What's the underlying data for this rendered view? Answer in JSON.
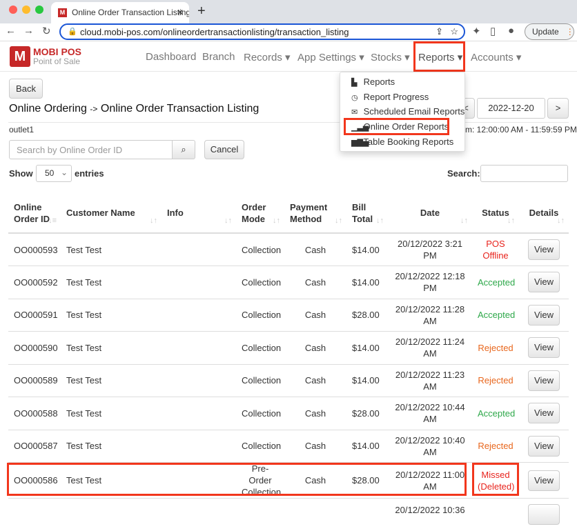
{
  "browser": {
    "tab_title": "Online Order Transaction Listing",
    "url": "cloud.mobi-pos.com/onlineordertransactionlisting/transaction_listing",
    "update_label": "Update"
  },
  "brand": {
    "name": "MOBI POS",
    "tagline": "Point of Sale",
    "color": "#c62828"
  },
  "nav": [
    "Dashboard",
    "Branch",
    "Records ▾",
    "App Settings ▾",
    "Stocks ▾",
    "Reports ▾",
    "Accounts ▾"
  ],
  "reports_menu": [
    {
      "icon": "file-icon",
      "glyph": "▙",
      "label": "Reports"
    },
    {
      "icon": "clock-icon",
      "glyph": "◷",
      "label": "Report Progress"
    },
    {
      "icon": "envelope-icon",
      "glyph": "✉",
      "label": "Scheduled Email Reports"
    },
    {
      "icon": "signal-icon",
      "glyph": "▁▃▅",
      "label": "Online Order Reports"
    },
    {
      "icon": "bar-chart-icon",
      "glyph": "▆▇▅",
      "label": "Table Booking Reports"
    }
  ],
  "page": {
    "back": "Back",
    "breadcrumb_1": "Online Ordering",
    "arrow": "->",
    "breadcrumb_2": "Online Order Transaction Listing",
    "outlet": "outlet1",
    "date": "2022-12-20",
    "prev": "<",
    "next": ">",
    "time_range": "m: 12:00:00 AM - 11:59:59 PM",
    "search_placeholder": "Search by Online Order ID",
    "cancel": "Cancel",
    "show": "Show",
    "entries_value": "50",
    "entries": "entries",
    "search_label": "Search:"
  },
  "table": {
    "headers": [
      "Online Order ID",
      "Customer Name",
      "Info",
      "Order Mode",
      "Payment Method",
      "Bill Total",
      "Date",
      "Status",
      "Details"
    ],
    "rows": [
      [
        "OO000593",
        "Test Test",
        "",
        "Collection",
        "Cash",
        "$14.00",
        "20/12/2022 3:21 PM",
        "POS Offline",
        "View",
        "#e8231c"
      ],
      [
        "OO000592",
        "Test Test",
        "",
        "Collection",
        "Cash",
        "$14.00",
        "20/12/2022 12:18 PM",
        "Accepted",
        "View",
        "#2ea84a"
      ],
      [
        "OO000591",
        "Test Test",
        "",
        "Collection",
        "Cash",
        "$28.00",
        "20/12/2022 11:28 AM",
        "Accepted",
        "View",
        "#2ea84a"
      ],
      [
        "OO000590",
        "Test Test",
        "",
        "Collection",
        "Cash",
        "$14.00",
        "20/12/2022 11:24 AM",
        "Rejected",
        "View",
        "#e8661c"
      ],
      [
        "OO000589",
        "Test Test",
        "",
        "Collection",
        "Cash",
        "$14.00",
        "20/12/2022 11:23 AM",
        "Rejected",
        "View",
        "#e8661c"
      ],
      [
        "OO000588",
        "Test Test",
        "",
        "Collection",
        "Cash",
        "$28.00",
        "20/12/2022 10:44 AM",
        "Accepted",
        "View",
        "#2ea84a"
      ],
      [
        "OO000587",
        "Test Test",
        "",
        "Collection",
        "Cash",
        "$14.00",
        "20/12/2022 10:40 AM",
        "Rejected",
        "View",
        "#e8661c"
      ],
      [
        "OO000586",
        "Test Test",
        "",
        "Pre-Order Collection",
        "Cash",
        "$28.00",
        "20/12/2022 11:00 AM",
        "Missed (Deleted)",
        "View",
        "#e8231c"
      ],
      [
        "",
        "",
        "",
        "",
        "",
        "",
        "20/12/2022 10:36",
        "",
        "",
        "#333"
      ]
    ]
  },
  "highlight_color": "#f2361c"
}
